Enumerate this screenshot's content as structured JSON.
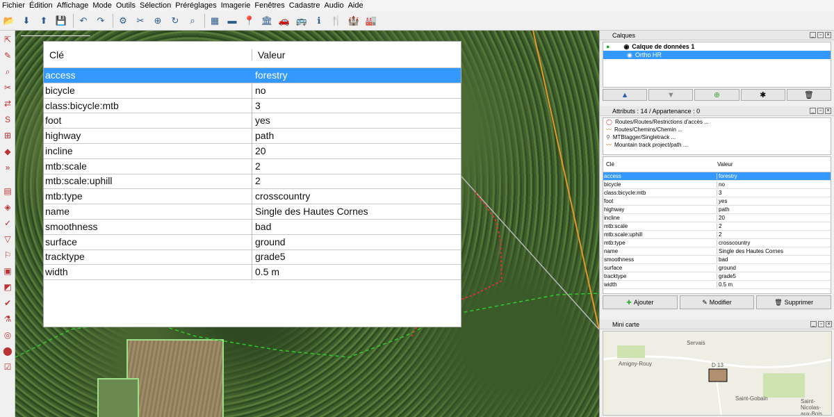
{
  "menu": [
    "Fichier",
    "Édition",
    "Affichage",
    "Mode",
    "Outils",
    "Sélection",
    "Préréglages",
    "Imagerie",
    "Fenêtres",
    "Cadastre",
    "Audio",
    "Aide"
  ],
  "toolbar_icons": [
    "open-icon",
    "download-icon",
    "upload-icon",
    "save-icon",
    "undo-icon",
    "redo-icon",
    "preferences-icon",
    "split-icon",
    "combine-icon",
    "refresh-icon",
    "zoom-icon",
    "road-icon",
    "stripe-icon",
    "pin-icon",
    "building-icon",
    "car-icon",
    "bus-icon",
    "info-icon",
    "food-icon",
    "castle-icon",
    "factory-icon"
  ],
  "tag_table": {
    "header_key": "Clé",
    "header_value": "Valeur",
    "rows": [
      {
        "k": "access",
        "v": "forestry"
      },
      {
        "k": "bicycle",
        "v": "no"
      },
      {
        "k": "class:bicycle:mtb",
        "v": "3"
      },
      {
        "k": "foot",
        "v": "yes"
      },
      {
        "k": "highway",
        "v": "path"
      },
      {
        "k": "incline",
        "v": "20"
      },
      {
        "k": "mtb:scale",
        "v": "2"
      },
      {
        "k": "mtb:scale:uphill",
        "v": "2"
      },
      {
        "k": "mtb:type",
        "v": "crosscountry"
      },
      {
        "k": "name",
        "v": "Single des Hautes Cornes"
      },
      {
        "k": "smoothness",
        "v": "bad"
      },
      {
        "k": "surface",
        "v": "ground"
      },
      {
        "k": "tracktype",
        "v": "grade5"
      },
      {
        "k": "width",
        "v": "0.5 m"
      }
    ]
  },
  "layers_panel": {
    "title": "Calques",
    "layers": [
      {
        "name": "Calque de données 1",
        "selected": false
      },
      {
        "name": "Ortho HR",
        "selected": true
      }
    ]
  },
  "attributes_panel": {
    "title": "Attributs : 14 / Appartenance : 0",
    "presets": [
      "Routes/Routes/Restrictions d'accès ...",
      "Routes/Chemins/Chemin ...",
      "MTBtagger/Singletrack ...",
      "Mountain track project/path ..."
    ],
    "header_key": "Clé",
    "header_value": "Valeur",
    "add_label": "Ajouter",
    "edit_label": "Modifier",
    "delete_label": "Supprimer"
  },
  "minimap": {
    "title": "Mini carte",
    "places": [
      "Servais",
      "Amigny-Rouy",
      "D 13",
      "Saint-Gobain",
      "Saint-Nicolas-aux-Bois"
    ]
  }
}
